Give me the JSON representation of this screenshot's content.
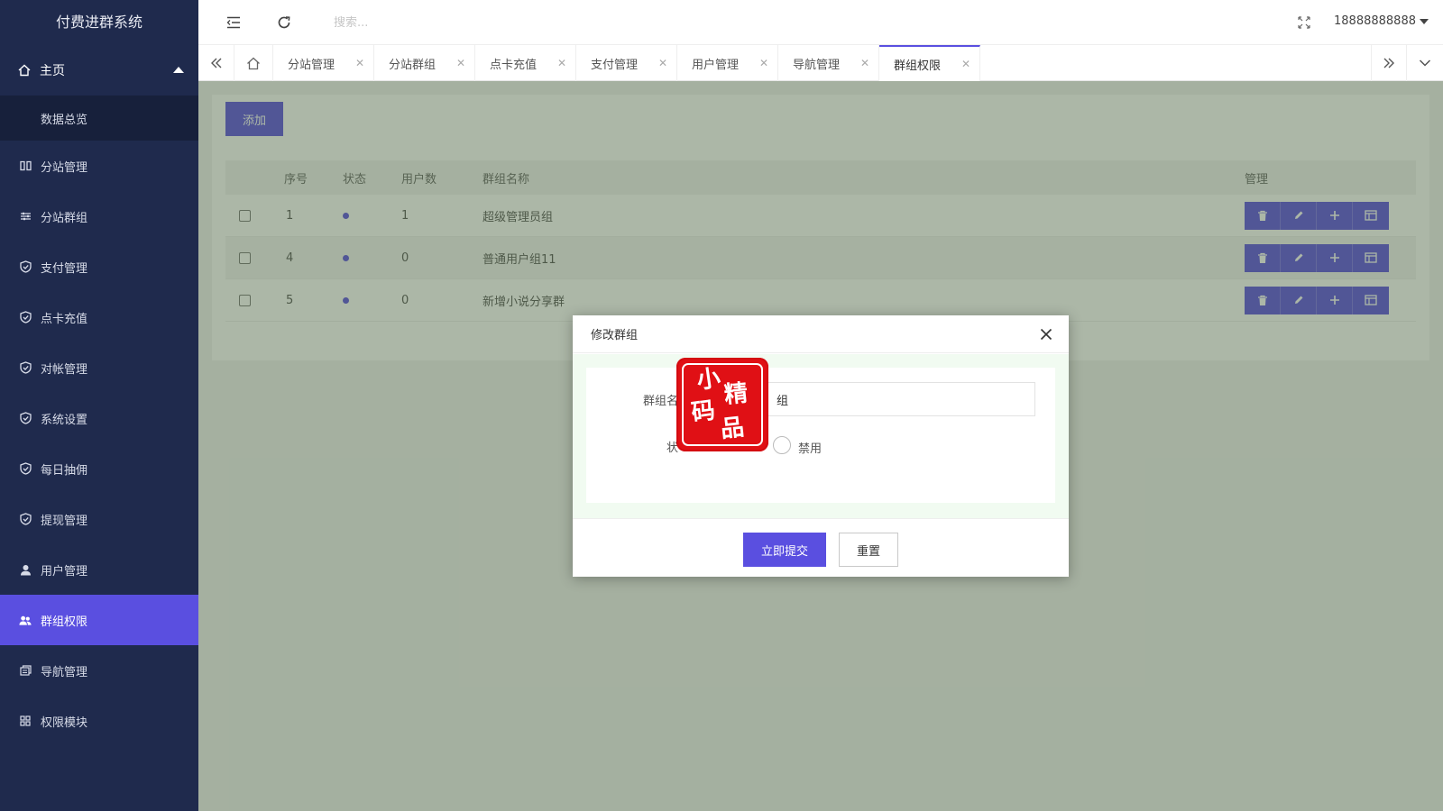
{
  "app": {
    "title": "付费进群系统"
  },
  "topbar": {
    "search_placeholder": "搜索...",
    "user": "18888888888"
  },
  "sidebar": {
    "home": {
      "label": "主页",
      "sub": "数据总览"
    },
    "items": [
      {
        "label": "分站管理",
        "icon": "columns-icon"
      },
      {
        "label": "分站群组",
        "icon": "sliders-icon"
      },
      {
        "label": "支付管理",
        "icon": "shield-check-icon"
      },
      {
        "label": "点卡充值",
        "icon": "shield-check-icon"
      },
      {
        "label": "对帐管理",
        "icon": "shield-check-icon"
      },
      {
        "label": "系统设置",
        "icon": "shield-check-icon"
      },
      {
        "label": "每日抽佣",
        "icon": "shield-check-icon"
      },
      {
        "label": "提现管理",
        "icon": "shield-check-icon"
      },
      {
        "label": "用户管理",
        "icon": "user-icon"
      },
      {
        "label": "群组权限",
        "icon": "users-icon",
        "active": true
      },
      {
        "label": "导航管理",
        "icon": "nav-icon"
      },
      {
        "label": "权限模块",
        "icon": "grid-icon"
      }
    ]
  },
  "tabs": [
    {
      "label": "分站管理"
    },
    {
      "label": "分站群组"
    },
    {
      "label": "点卡充值"
    },
    {
      "label": "支付管理"
    },
    {
      "label": "用户管理"
    },
    {
      "label": "导航管理"
    },
    {
      "label": "群组权限",
      "active": true
    }
  ],
  "main": {
    "add_label": "添加",
    "columns": {
      "seq": "序号",
      "status": "状态",
      "users": "用户数",
      "name": "群组名称",
      "manage": "管理"
    },
    "rows": [
      {
        "seq": "1",
        "users": "1",
        "name": "超级管理员组"
      },
      {
        "seq": "4",
        "users": "0",
        "name": "普通用户组11"
      },
      {
        "seq": "5",
        "users": "0",
        "name": "新增小说分享群"
      }
    ]
  },
  "modal": {
    "title": "修改群组",
    "name_label": "群组名",
    "name_value": "组",
    "status_label": "状",
    "radio_disabled": "禁用",
    "submit": "立即提交",
    "reset": "重置"
  },
  "stamp": {
    "text": "小码精品"
  },
  "colors": {
    "accent": "#5a4fe0",
    "sidebar": "#1f2a4d",
    "stamp": "#e01015"
  }
}
